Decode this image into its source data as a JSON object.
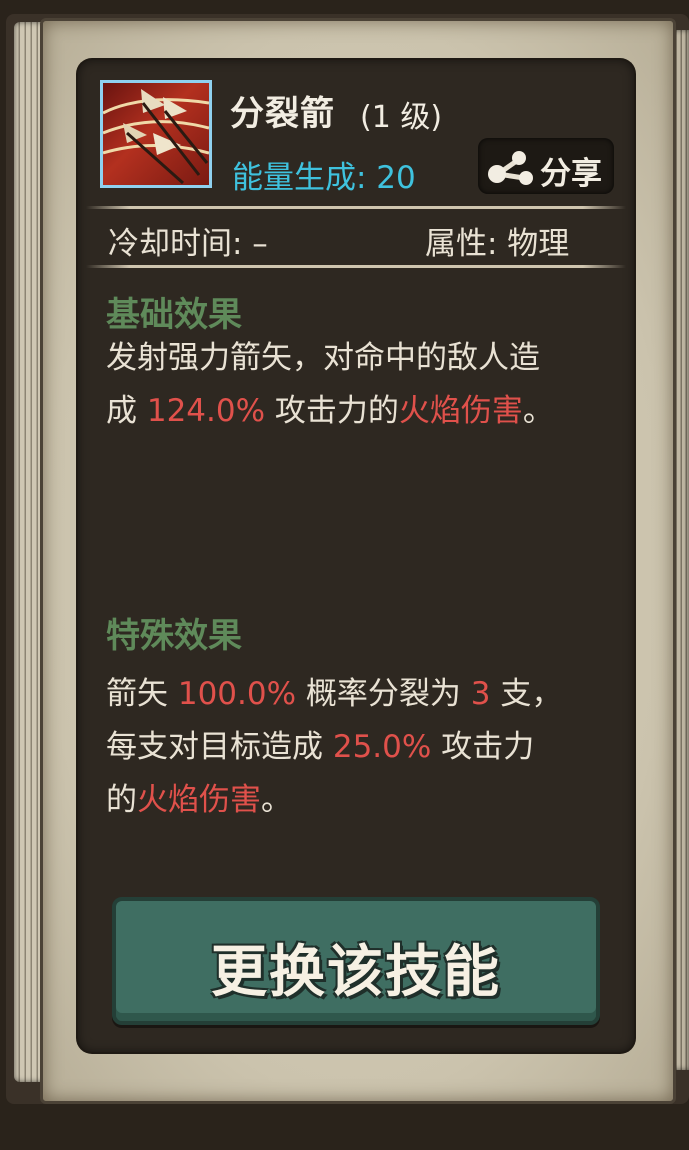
{
  "skill": {
    "icon": "split-arrow-icon",
    "name": "分裂箭",
    "level": "(1 级)",
    "energy": "能量生成: 20",
    "share_label": "分享",
    "cooldown": "冷却时间: –",
    "attribute": "属性: 物理"
  },
  "base_effect": {
    "title": "基础效果",
    "line1": "发射强力箭矢，对命中的敌人造",
    "line2_pre": "成 ",
    "line2_value": "124.0%",
    "line2_mid": " 攻击力的",
    "line2_hl": "火焰伤害",
    "line2_end": "。"
  },
  "special_effect": {
    "title": "特殊效果",
    "line1_pre": "箭矢 ",
    "line1_value": "100.0%",
    "line1_mid": " 概率分裂为 ",
    "line1_count": "3",
    "line1_end": " 支，",
    "line2_pre": "每支对目标造成 ",
    "line2_value": "25.0%",
    "line2_end": " 攻击力",
    "line3_pre": "的",
    "line3_hl": "火焰伤害",
    "line3_end": "。"
  },
  "actions": {
    "swap_label": "更换该技能"
  },
  "colors": {
    "energy": "#3fc2de",
    "highlight": "#e0514b",
    "section_title": "#5f8a5a",
    "button": "#3f6e62"
  }
}
